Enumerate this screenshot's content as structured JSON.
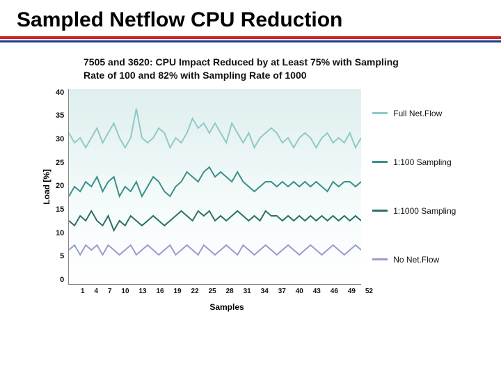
{
  "title": "Sampled Netflow CPU Reduction",
  "chart_data": {
    "type": "line",
    "title": "7505 and 3620: CPU Impact Reduced by at Least 75% with Sampling Rate of 100 and 82% with Sampling Rate of 1000",
    "xlabel": "Samples",
    "ylabel": "Load [%]",
    "ylim": [
      0,
      40
    ],
    "yticks": [
      0,
      5,
      10,
      15,
      20,
      25,
      30,
      35,
      40
    ],
    "x": [
      1,
      2,
      3,
      4,
      5,
      6,
      7,
      8,
      9,
      10,
      11,
      12,
      13,
      14,
      15,
      16,
      17,
      18,
      19,
      20,
      21,
      22,
      23,
      24,
      25,
      26,
      27,
      28,
      29,
      30,
      31,
      32,
      33,
      34,
      35,
      36,
      37,
      38,
      39,
      40,
      41,
      42,
      43,
      44,
      45,
      46,
      47,
      48,
      49,
      50,
      51,
      52,
      53
    ],
    "xticks": [
      1,
      4,
      7,
      10,
      13,
      16,
      19,
      22,
      25,
      28,
      31,
      34,
      37,
      40,
      43,
      46,
      49,
      52
    ],
    "series": [
      {
        "name": "Full Net.Flow",
        "color": "#8fc9c6",
        "values": [
          31,
          29,
          30,
          28,
          30,
          32,
          29,
          31,
          33,
          30,
          28,
          30,
          36,
          30,
          29,
          30,
          32,
          31,
          28,
          30,
          29,
          31,
          34,
          32,
          33,
          31,
          33,
          31,
          29,
          33,
          31,
          29,
          31,
          28,
          30,
          31,
          32,
          31,
          29,
          30,
          28,
          30,
          31,
          30,
          28,
          30,
          31,
          29,
          30,
          29,
          31,
          28,
          30
        ]
      },
      {
        "name": "1:100 Sampling",
        "color": "#3a8f88",
        "values": [
          18,
          20,
          19,
          21,
          20,
          22,
          19,
          21,
          22,
          18,
          20,
          19,
          21,
          18,
          20,
          22,
          21,
          19,
          18,
          20,
          21,
          23,
          22,
          21,
          23,
          24,
          22,
          23,
          22,
          21,
          23,
          21,
          20,
          19,
          20,
          21,
          21,
          20,
          21,
          20,
          21,
          20,
          21,
          20,
          21,
          20,
          19,
          21,
          20,
          21,
          21,
          20,
          21
        ]
      },
      {
        "name": "1:1000 Sampling",
        "color": "#2d6e68",
        "values": [
          13,
          12,
          14,
          13,
          15,
          13,
          12,
          14,
          11,
          13,
          12,
          14,
          13,
          12,
          13,
          14,
          13,
          12,
          13,
          14,
          15,
          14,
          13,
          15,
          14,
          15,
          13,
          14,
          13,
          14,
          15,
          14,
          13,
          14,
          13,
          15,
          14,
          14,
          13,
          14,
          13,
          14,
          13,
          14,
          13,
          14,
          13,
          14,
          13,
          14,
          13,
          14,
          13
        ]
      },
      {
        "name": "No Net.Flow",
        "color": "#9a9acb",
        "values": [
          7,
          8,
          6,
          8,
          7,
          8,
          6,
          8,
          7,
          6,
          7,
          8,
          6,
          7,
          8,
          7,
          6,
          7,
          8,
          6,
          7,
          8,
          7,
          6,
          8,
          7,
          6,
          7,
          8,
          7,
          6,
          8,
          7,
          6,
          7,
          8,
          7,
          6,
          7,
          8,
          7,
          6,
          7,
          8,
          7,
          6,
          7,
          8,
          7,
          6,
          7,
          8,
          7
        ]
      }
    ]
  }
}
